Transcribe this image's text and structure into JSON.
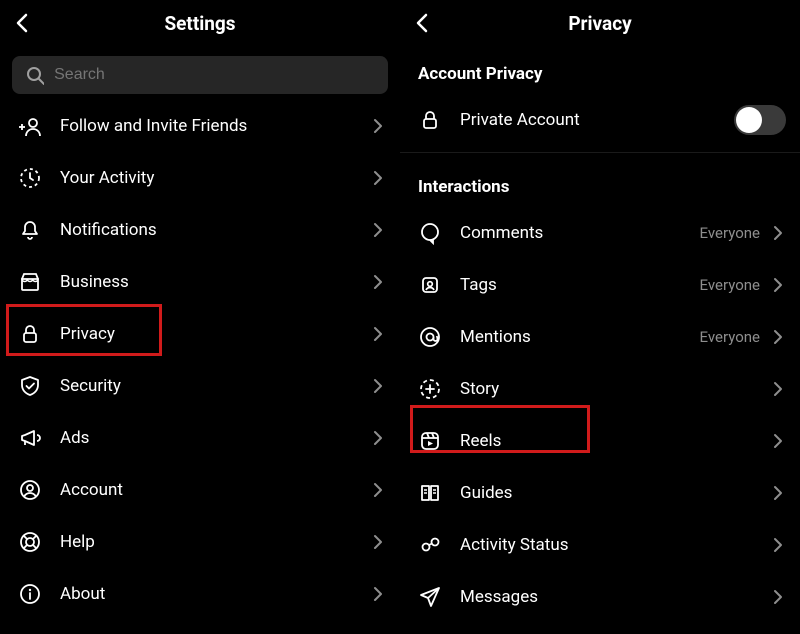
{
  "left": {
    "title": "Settings",
    "search_placeholder": "Search",
    "items": [
      {
        "icon": "add-user-icon",
        "label": "Follow and Invite Friends"
      },
      {
        "icon": "clock-icon",
        "label": "Your Activity"
      },
      {
        "icon": "bell-icon",
        "label": "Notifications"
      },
      {
        "icon": "storefront-icon",
        "label": "Business"
      },
      {
        "icon": "lock-icon",
        "label": "Privacy"
      },
      {
        "icon": "shield-check-icon",
        "label": "Security"
      },
      {
        "icon": "megaphone-icon",
        "label": "Ads"
      },
      {
        "icon": "person-circle-icon",
        "label": "Account"
      },
      {
        "icon": "life-ring-icon",
        "label": "Help"
      },
      {
        "icon": "info-icon",
        "label": "About"
      }
    ],
    "highlighted": "Privacy"
  },
  "right": {
    "title": "Privacy",
    "section_account": "Account Privacy",
    "private_account_label": "Private Account",
    "private_account_on": false,
    "section_interactions": "Interactions",
    "items": [
      {
        "icon": "comment-icon",
        "label": "Comments",
        "value": "Everyone"
      },
      {
        "icon": "tags-icon",
        "label": "Tags",
        "value": "Everyone"
      },
      {
        "icon": "mention-icon",
        "label": "Mentions",
        "value": "Everyone"
      },
      {
        "icon": "story-add-icon",
        "label": "Story",
        "value": ""
      },
      {
        "icon": "reels-icon",
        "label": "Reels",
        "value": ""
      },
      {
        "icon": "guides-icon",
        "label": "Guides",
        "value": ""
      },
      {
        "icon": "activity-status-icon",
        "label": "Activity Status",
        "value": ""
      },
      {
        "icon": "messages-icon",
        "label": "Messages",
        "value": ""
      }
    ],
    "highlighted": "Reels"
  }
}
